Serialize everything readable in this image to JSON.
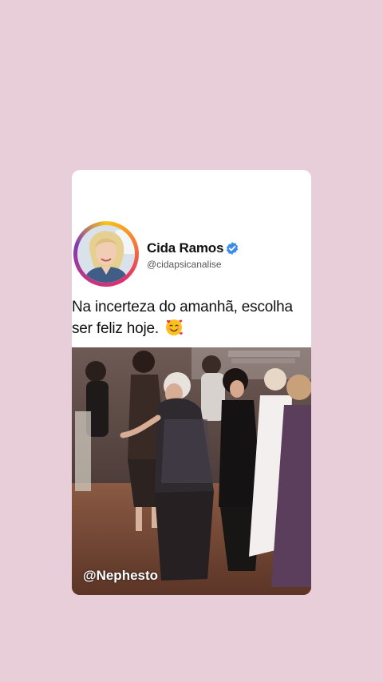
{
  "post": {
    "author_name": "Cida Ramos",
    "author_handle": "@cidapsicanalise",
    "text": "Na incerteza do amanhã, escolha ser feliz hoje.",
    "emoji": "smiling-face-with-hearts"
  },
  "video": {
    "watermark": "@Nephesto"
  },
  "colors": {
    "background": "#e7ced8",
    "card": "#ffffff",
    "verified": "#3b8de8"
  }
}
